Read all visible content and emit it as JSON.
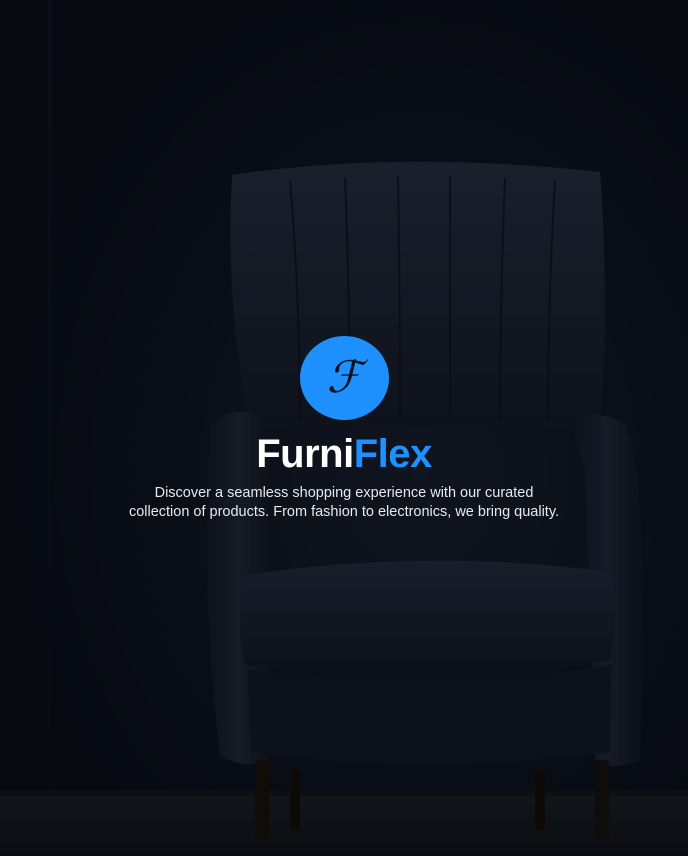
{
  "brand": {
    "logo_glyph": "ℱ",
    "name_part1": "Furni",
    "name_part2": "Flex",
    "accent_color": "#1e90ff",
    "text_color": "#ffffff"
  },
  "hero": {
    "tagline": "Discover a seamless shopping experience with our curated collection of products. From fashion to electronics, we bring quality.",
    "background_image": "dark-armchair-photo"
  }
}
